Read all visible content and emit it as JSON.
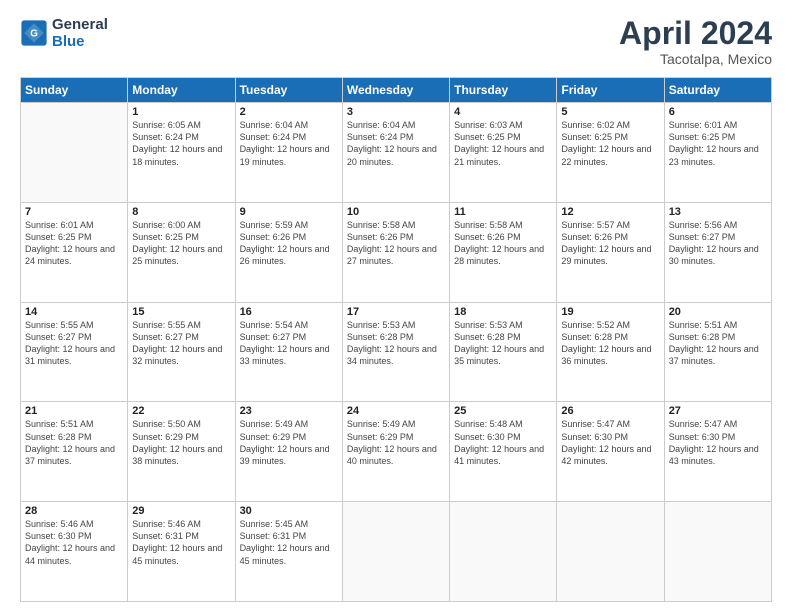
{
  "logo": {
    "text_general": "General",
    "text_blue": "Blue"
  },
  "header": {
    "month": "April 2024",
    "location": "Tacotalpa, Mexico"
  },
  "weekdays": [
    "Sunday",
    "Monday",
    "Tuesday",
    "Wednesday",
    "Thursday",
    "Friday",
    "Saturday"
  ],
  "weeks": [
    [
      {
        "day": "",
        "sunrise": "",
        "sunset": "",
        "daylight": ""
      },
      {
        "day": "1",
        "sunrise": "Sunrise: 6:05 AM",
        "sunset": "Sunset: 6:24 PM",
        "daylight": "Daylight: 12 hours and 18 minutes."
      },
      {
        "day": "2",
        "sunrise": "Sunrise: 6:04 AM",
        "sunset": "Sunset: 6:24 PM",
        "daylight": "Daylight: 12 hours and 19 minutes."
      },
      {
        "day": "3",
        "sunrise": "Sunrise: 6:04 AM",
        "sunset": "Sunset: 6:24 PM",
        "daylight": "Daylight: 12 hours and 20 minutes."
      },
      {
        "day": "4",
        "sunrise": "Sunrise: 6:03 AM",
        "sunset": "Sunset: 6:25 PM",
        "daylight": "Daylight: 12 hours and 21 minutes."
      },
      {
        "day": "5",
        "sunrise": "Sunrise: 6:02 AM",
        "sunset": "Sunset: 6:25 PM",
        "daylight": "Daylight: 12 hours and 22 minutes."
      },
      {
        "day": "6",
        "sunrise": "Sunrise: 6:01 AM",
        "sunset": "Sunset: 6:25 PM",
        "daylight": "Daylight: 12 hours and 23 minutes."
      }
    ],
    [
      {
        "day": "7",
        "sunrise": "Sunrise: 6:01 AM",
        "sunset": "Sunset: 6:25 PM",
        "daylight": "Daylight: 12 hours and 24 minutes."
      },
      {
        "day": "8",
        "sunrise": "Sunrise: 6:00 AM",
        "sunset": "Sunset: 6:25 PM",
        "daylight": "Daylight: 12 hours and 25 minutes."
      },
      {
        "day": "9",
        "sunrise": "Sunrise: 5:59 AM",
        "sunset": "Sunset: 6:26 PM",
        "daylight": "Daylight: 12 hours and 26 minutes."
      },
      {
        "day": "10",
        "sunrise": "Sunrise: 5:58 AM",
        "sunset": "Sunset: 6:26 PM",
        "daylight": "Daylight: 12 hours and 27 minutes."
      },
      {
        "day": "11",
        "sunrise": "Sunrise: 5:58 AM",
        "sunset": "Sunset: 6:26 PM",
        "daylight": "Daylight: 12 hours and 28 minutes."
      },
      {
        "day": "12",
        "sunrise": "Sunrise: 5:57 AM",
        "sunset": "Sunset: 6:26 PM",
        "daylight": "Daylight: 12 hours and 29 minutes."
      },
      {
        "day": "13",
        "sunrise": "Sunrise: 5:56 AM",
        "sunset": "Sunset: 6:27 PM",
        "daylight": "Daylight: 12 hours and 30 minutes."
      }
    ],
    [
      {
        "day": "14",
        "sunrise": "Sunrise: 5:55 AM",
        "sunset": "Sunset: 6:27 PM",
        "daylight": "Daylight: 12 hours and 31 minutes."
      },
      {
        "day": "15",
        "sunrise": "Sunrise: 5:55 AM",
        "sunset": "Sunset: 6:27 PM",
        "daylight": "Daylight: 12 hours and 32 minutes."
      },
      {
        "day": "16",
        "sunrise": "Sunrise: 5:54 AM",
        "sunset": "Sunset: 6:27 PM",
        "daylight": "Daylight: 12 hours and 33 minutes."
      },
      {
        "day": "17",
        "sunrise": "Sunrise: 5:53 AM",
        "sunset": "Sunset: 6:28 PM",
        "daylight": "Daylight: 12 hours and 34 minutes."
      },
      {
        "day": "18",
        "sunrise": "Sunrise: 5:53 AM",
        "sunset": "Sunset: 6:28 PM",
        "daylight": "Daylight: 12 hours and 35 minutes."
      },
      {
        "day": "19",
        "sunrise": "Sunrise: 5:52 AM",
        "sunset": "Sunset: 6:28 PM",
        "daylight": "Daylight: 12 hours and 36 minutes."
      },
      {
        "day": "20",
        "sunrise": "Sunrise: 5:51 AM",
        "sunset": "Sunset: 6:28 PM",
        "daylight": "Daylight: 12 hours and 37 minutes."
      }
    ],
    [
      {
        "day": "21",
        "sunrise": "Sunrise: 5:51 AM",
        "sunset": "Sunset: 6:28 PM",
        "daylight": "Daylight: 12 hours and 37 minutes."
      },
      {
        "day": "22",
        "sunrise": "Sunrise: 5:50 AM",
        "sunset": "Sunset: 6:29 PM",
        "daylight": "Daylight: 12 hours and 38 minutes."
      },
      {
        "day": "23",
        "sunrise": "Sunrise: 5:49 AM",
        "sunset": "Sunset: 6:29 PM",
        "daylight": "Daylight: 12 hours and 39 minutes."
      },
      {
        "day": "24",
        "sunrise": "Sunrise: 5:49 AM",
        "sunset": "Sunset: 6:29 PM",
        "daylight": "Daylight: 12 hours and 40 minutes."
      },
      {
        "day": "25",
        "sunrise": "Sunrise: 5:48 AM",
        "sunset": "Sunset: 6:30 PM",
        "daylight": "Daylight: 12 hours and 41 minutes."
      },
      {
        "day": "26",
        "sunrise": "Sunrise: 5:47 AM",
        "sunset": "Sunset: 6:30 PM",
        "daylight": "Daylight: 12 hours and 42 minutes."
      },
      {
        "day": "27",
        "sunrise": "Sunrise: 5:47 AM",
        "sunset": "Sunset: 6:30 PM",
        "daylight": "Daylight: 12 hours and 43 minutes."
      }
    ],
    [
      {
        "day": "28",
        "sunrise": "Sunrise: 5:46 AM",
        "sunset": "Sunset: 6:30 PM",
        "daylight": "Daylight: 12 hours and 44 minutes."
      },
      {
        "day": "29",
        "sunrise": "Sunrise: 5:46 AM",
        "sunset": "Sunset: 6:31 PM",
        "daylight": "Daylight: 12 hours and 45 minutes."
      },
      {
        "day": "30",
        "sunrise": "Sunrise: 5:45 AM",
        "sunset": "Sunset: 6:31 PM",
        "daylight": "Daylight: 12 hours and 45 minutes."
      },
      {
        "day": "",
        "sunrise": "",
        "sunset": "",
        "daylight": ""
      },
      {
        "day": "",
        "sunrise": "",
        "sunset": "",
        "daylight": ""
      },
      {
        "day": "",
        "sunrise": "",
        "sunset": "",
        "daylight": ""
      },
      {
        "day": "",
        "sunrise": "",
        "sunset": "",
        "daylight": ""
      }
    ]
  ]
}
